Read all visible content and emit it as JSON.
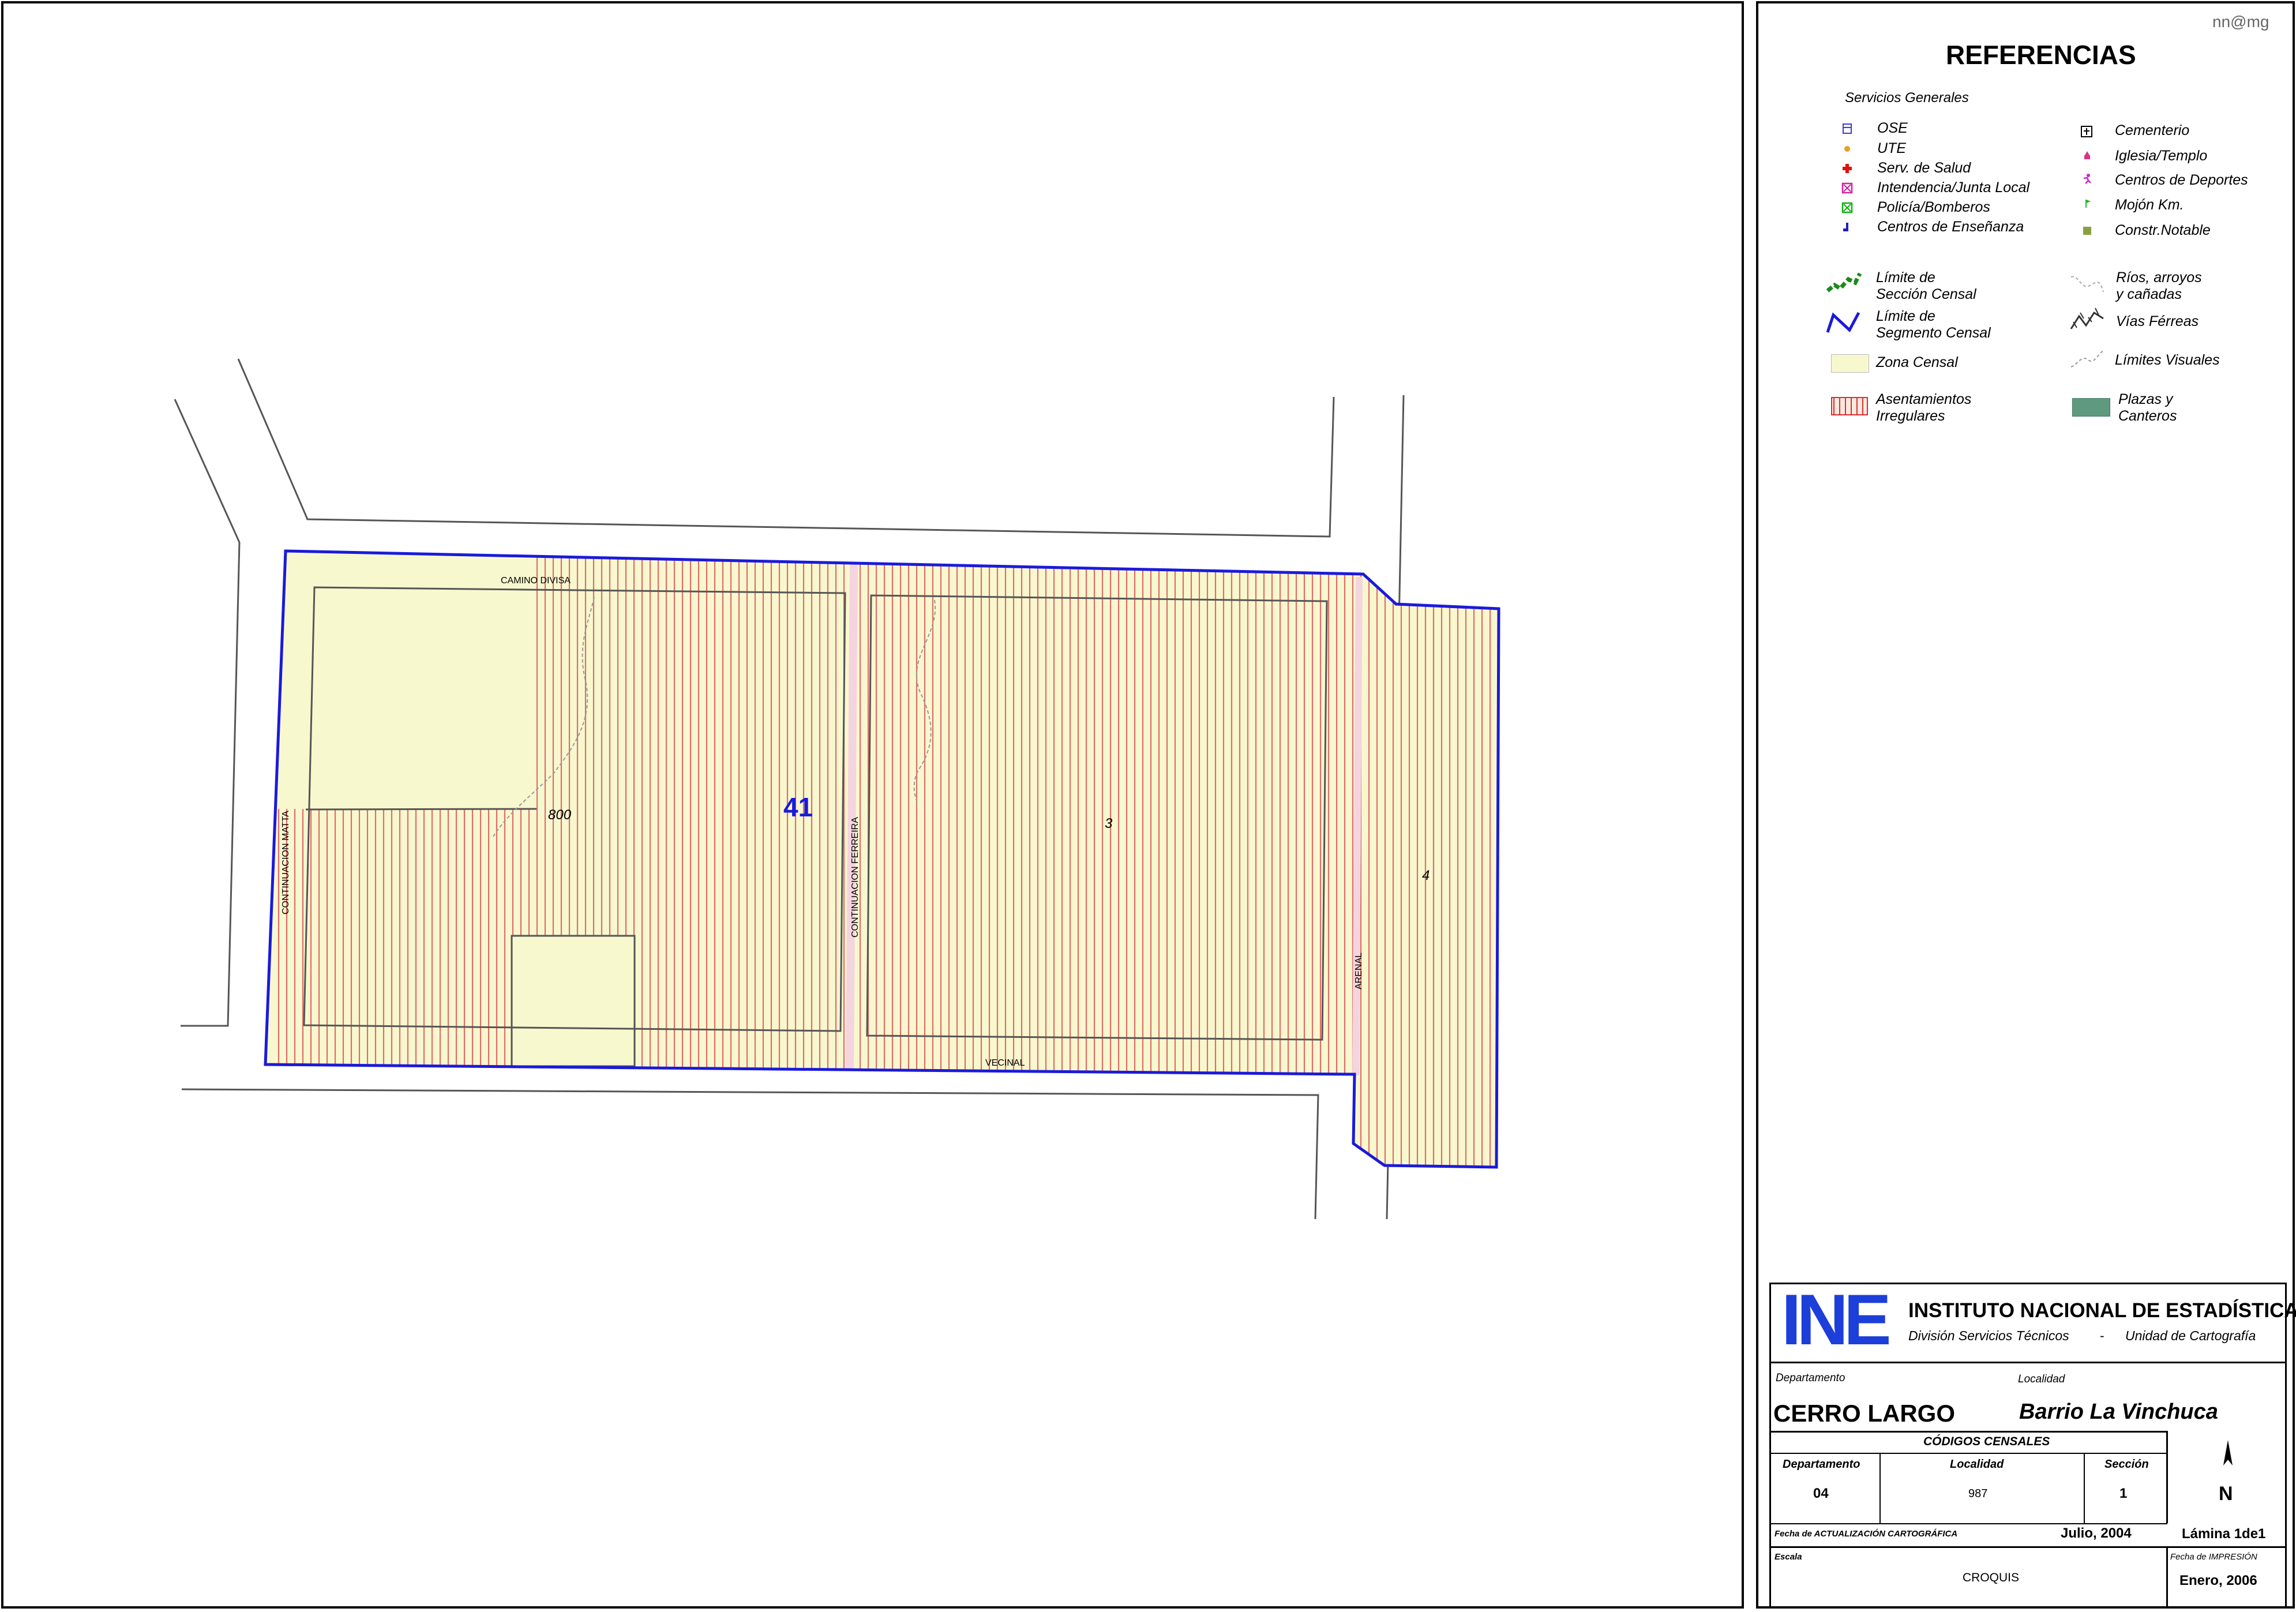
{
  "author_tag": "nn@mg",
  "legend": {
    "title": "REFERENCIAS",
    "services_heading": "Servicios Generales",
    "services_left": [
      "OSE",
      "UTE",
      "Serv. de Salud",
      "Intendencia/Junta Local",
      "Policía/Bomberos",
      "Centros de Enseñanza"
    ],
    "services_right": [
      "Cementerio",
      "Iglesia/Templo",
      "Centros de Deportes",
      "Mojón Km.",
      "Constr.Notable"
    ],
    "limite_seccion": [
      "Límite de",
      "Sección Censal"
    ],
    "limite_segmento": [
      "Límite de",
      "Segmento Censal"
    ],
    "zona_censal": "Zona Censal",
    "asentamientos": [
      "Asentamientos",
      "Irregulares"
    ],
    "rios": [
      "Ríos, arroyos",
      "y cañadas"
    ],
    "vias": "Vías Férreas",
    "limites_visuales": "Límites  Visuales",
    "plazas": [
      "Plazas y",
      "Canteros"
    ]
  },
  "map": {
    "segment_number": "41",
    "zone_labels": [
      "800",
      "3",
      "4"
    ],
    "streets": [
      "CAMINO DIVISA",
      "CONTINUACION MATTA",
      "CONTINUACION FERREIRA",
      "VECINAL",
      "ARENAL"
    ]
  },
  "title_block": {
    "org_logo": "INE",
    "org_name": "INSTITUTO NACIONAL DE ESTADÍSTICA",
    "org_sub_left": "División Servicios Técnicos",
    "org_sub_sep": "-",
    "org_sub_right": "Unidad de Cartografía",
    "departamento_label": "Departamento",
    "localidad_label": "Localidad",
    "departamento_value": "CERRO LARGO",
    "localidad_value": "Barrio La Vinchuca",
    "codes_heading": "CÓDIGOS CENSALES",
    "code_dep_label": "Departamento",
    "code_loc_label": "Localidad",
    "code_sec_label": "Sección",
    "code_dep_value": "04",
    "code_loc_value": "987",
    "code_sec_value": "1",
    "north": "N",
    "lamina": "Lámina 1de1",
    "fecha_act_label": "Fecha de ACTUALIZACIÓN CARTOGRÁFICA",
    "fecha_act_value": "Julio, 2004",
    "escala_label": "Escala",
    "escala_value": "CROQUIS",
    "fecha_imp_label": "Fecha de IMPRESIÓN",
    "fecha_imp_value": "Enero, 2006"
  },
  "colors": {
    "zone_fill": "#f8f8cf",
    "hatch": "#e36a6a",
    "segment_border": "#1a1adb",
    "street": "#555555",
    "ine_blue": "#1c3fd9"
  }
}
